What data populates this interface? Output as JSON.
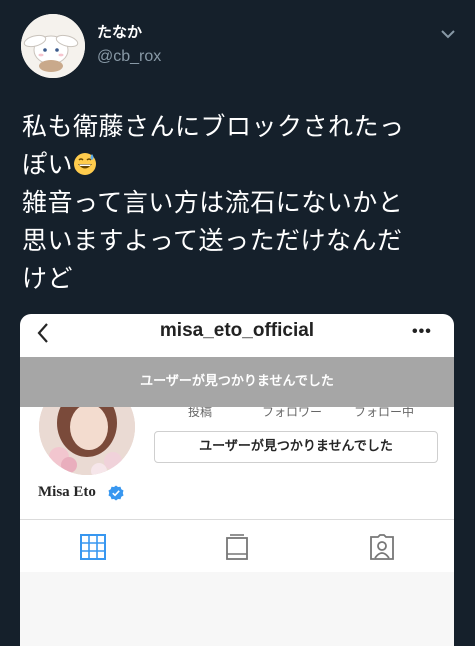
{
  "tweet": {
    "display_name": "たなか",
    "handle": "@cb_rox",
    "text_lines": [
      "私も衛藤さんにブロックされたっ",
      "ぽい",
      "雑音って言い方は流石にないかと",
      "思いますよって送っただけなんだ",
      "けど"
    ],
    "emoji": "grinning-face-with-sweat-emoji"
  },
  "instagram": {
    "username": "misa_eto_official",
    "banner_text": "ユーザーが見つかりませんでした",
    "stats": [
      "投稿",
      "フォロワー",
      "フォロー中"
    ],
    "button_label": "ユーザーが見つかりませんでした",
    "profile_name": "Misa Eto",
    "tabs": [
      "grid-icon",
      "igtv-icon",
      "tagged-icon"
    ]
  },
  "colors": {
    "background": "#15202b",
    "handle": "#8899a6",
    "banner": "#a6a6a6",
    "tab_active": "#3897f0",
    "verified": "#3897f0"
  }
}
